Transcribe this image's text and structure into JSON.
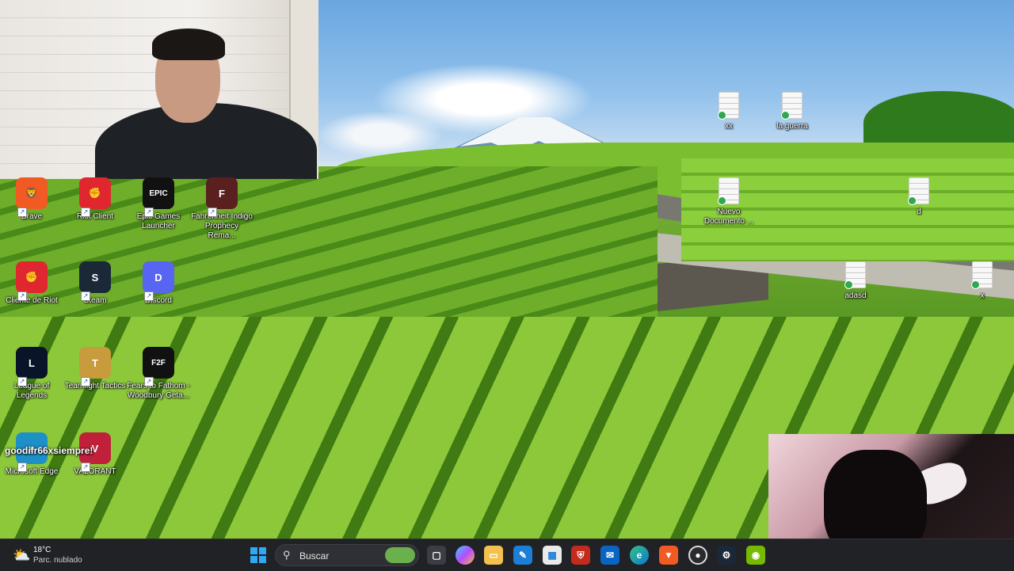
{
  "desktop": {
    "left_icons": [
      {
        "name": "brave-icon",
        "label": "Brave",
        "color": "#f15a22",
        "glyph": "🦁"
      },
      {
        "name": "riot-client-icon",
        "label": "Riot Client",
        "color": "#e0262f",
        "glyph": "✊"
      },
      {
        "name": "epic-games-icon",
        "label": "Epic Games Launcher",
        "color": "#111111",
        "glyph": "EPIC"
      },
      {
        "name": "fahrenheit-icon",
        "label": "Fahrenheit Indigo Prophecy Rema...",
        "color": "#5a2020",
        "glyph": "F"
      },
      {
        "name": "cliente-de-riot-icon",
        "label": "Cliente de Riot",
        "color": "#e0262f",
        "glyph": "✊"
      },
      {
        "name": "steam-icon",
        "label": "Steam",
        "color": "#1b2838",
        "glyph": "S"
      },
      {
        "name": "discord-icon",
        "label": "Discord",
        "color": "#5865f2",
        "glyph": "D"
      },
      {
        "name": "league-of-legends-icon",
        "label": "League of Legends",
        "color": "#0a1428",
        "glyph": "L"
      },
      {
        "name": "teamfight-tactics-icon",
        "label": "Teamfight Tactics",
        "color": "#c89b3c",
        "glyph": "T"
      },
      {
        "name": "fears-to-fathom-icon",
        "label": "Fears to Fathom - Woodbury Geta...",
        "color": "#111111",
        "glyph": "F2F"
      },
      {
        "name": "microsoft-edge-icon",
        "label": "Microsoft Edge",
        "color": "#1e90c8",
        "glyph": "e"
      },
      {
        "name": "valorant-icon",
        "label": "VALORANT",
        "color": "#c0203a",
        "glyph": "V"
      }
    ],
    "right_icons": [
      {
        "name": "file-xx",
        "label": "xx"
      },
      {
        "name": "file-la-guerra",
        "label": "la guerra"
      },
      {
        "name": "file-nuevo-documento",
        "label": "Nuevo Documento ..."
      },
      {
        "name": "file-d",
        "label": "d"
      },
      {
        "name": "file-adasd",
        "label": "adasd"
      },
      {
        "name": "file-x",
        "label": "x"
      }
    ],
    "overlay_text": "goodifr66xsiempre!"
  },
  "taskbar": {
    "weather": {
      "temp": "18°C",
      "condition": "Parc. nublado"
    },
    "search_placeholder": "Buscar"
  },
  "colors": {
    "taskbar": "#202226",
    "accent": "#0078d4"
  }
}
